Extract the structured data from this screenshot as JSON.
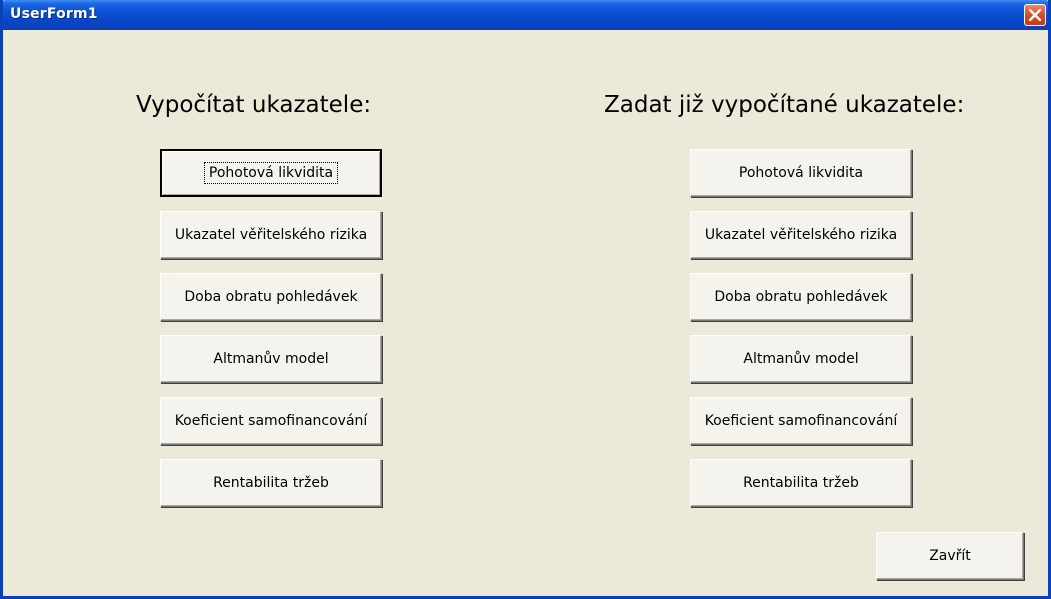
{
  "window": {
    "title": "UserForm1",
    "close_icon": "close-x-icon",
    "colors": {
      "title_bar": "#0a54d8",
      "close_button": "#d6512d",
      "face": "#ece9d8"
    }
  },
  "left": {
    "heading": "Vypočítat ukazatele:",
    "buttons": [
      "Pohotová likvidita",
      "Ukazatel věřitelského rizika",
      "Doba obratu pohledávek",
      "Altmanův model",
      "Koeficient samofinancování",
      "Rentabilita tržeb"
    ]
  },
  "right": {
    "heading": "Zadat již vypočítané ukazatele:",
    "buttons": [
      "Pohotová likvidita",
      "Ukazatel věřitelského rizika",
      "Doba obratu pohledávek",
      "Altmanův model",
      "Koeficient samofinancování",
      "Rentabilita tržeb"
    ]
  },
  "close_label": "Zavřít"
}
